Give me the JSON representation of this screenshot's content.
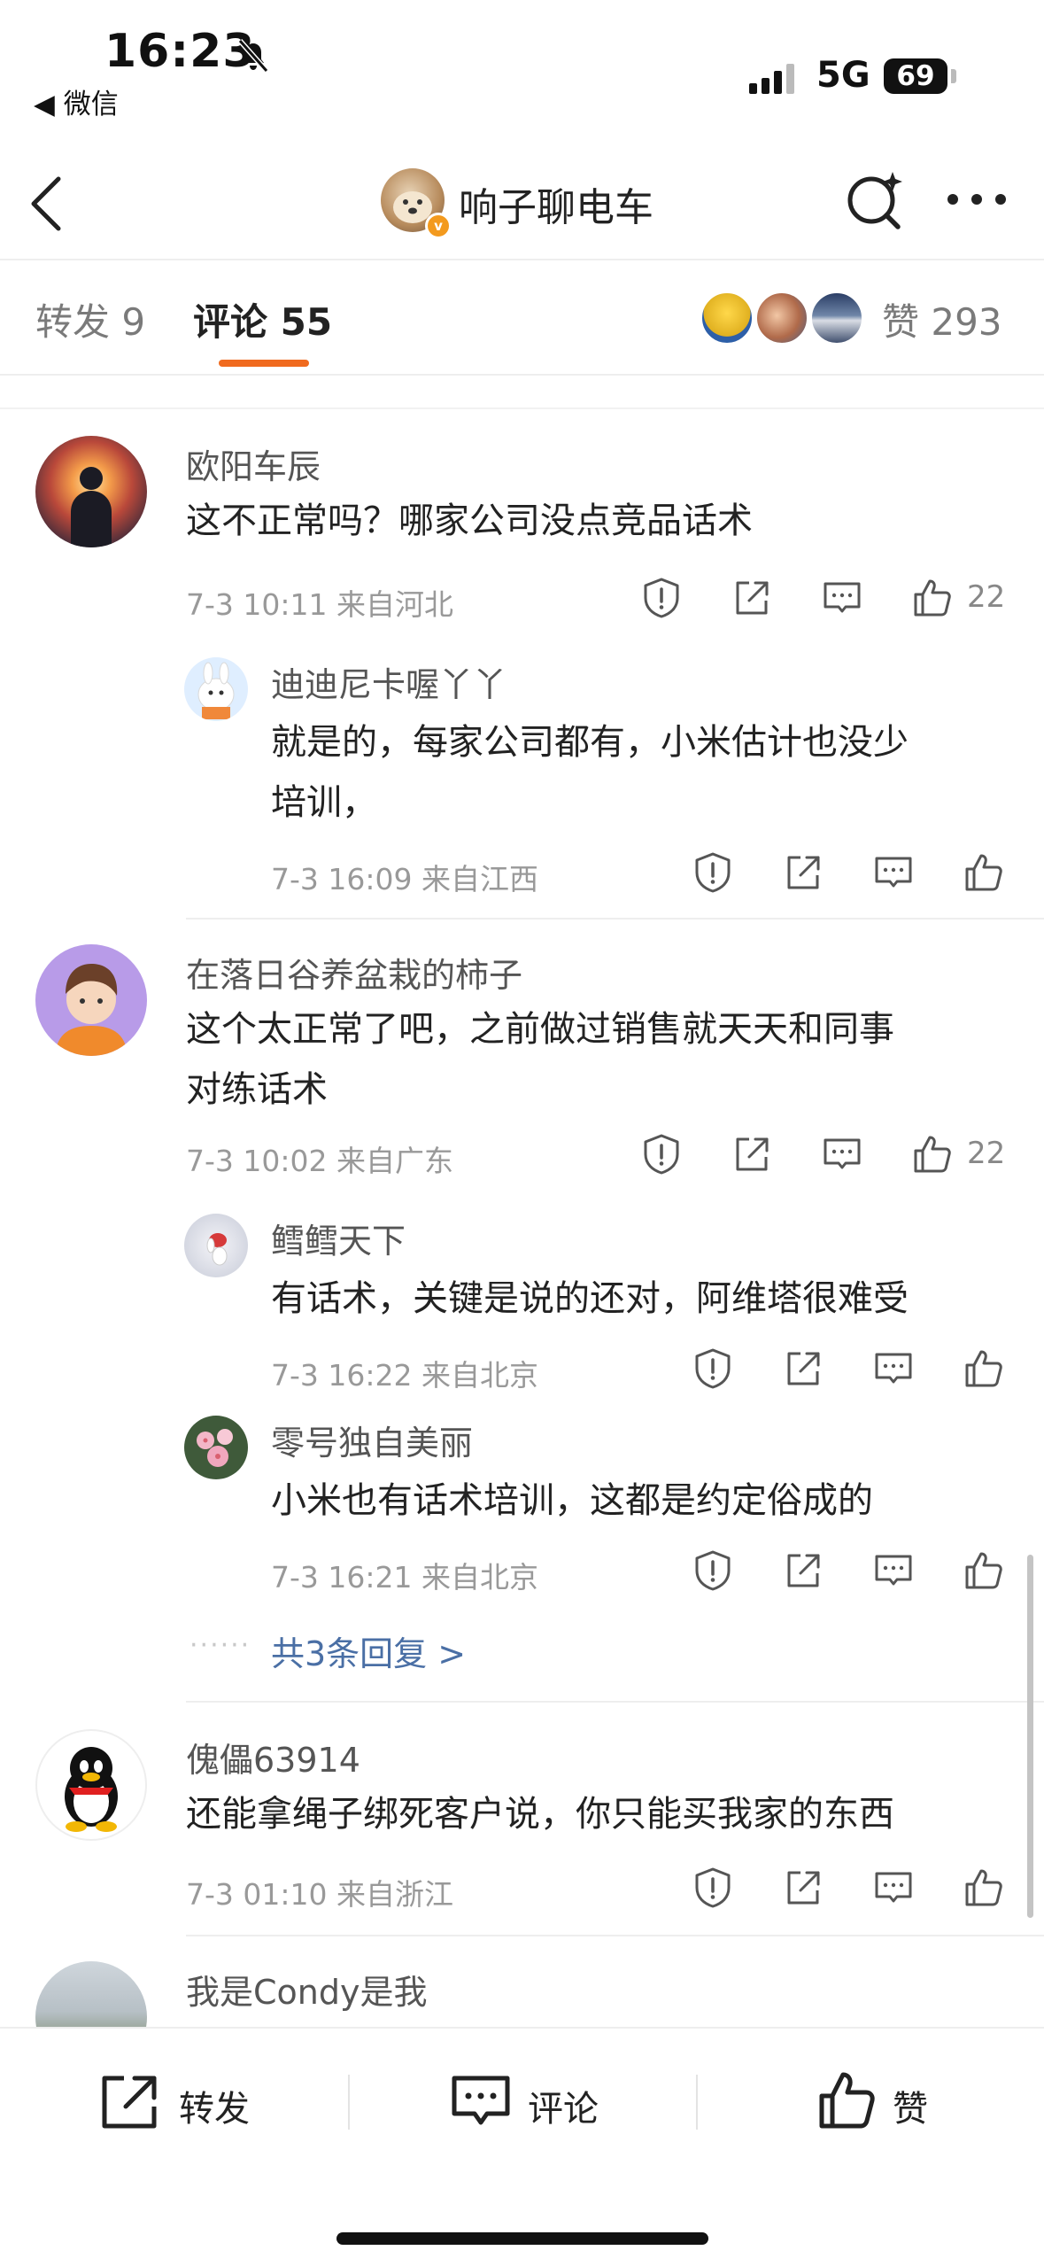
{
  "status_bar": {
    "time": "16:23",
    "back_app": "◀ 微信",
    "network": "5G",
    "battery": "69"
  },
  "nav": {
    "title": "响子聊电车",
    "verified_mark": "v"
  },
  "tabs": {
    "repost": "转发 9",
    "comment": "评论 55",
    "likes": "赞 293"
  },
  "comments": [
    {
      "user": "欧阳车辰",
      "text": "这不正常吗？哪家公司没点竞品话术",
      "meta": "7-3 10:11 来自河北",
      "likes": "22",
      "replies": [
        {
          "user": "迪迪尼卡喔丫丫",
          "text_lines": [
            "就是的，每家公司都有，小米估计也没少",
            "培训，"
          ],
          "meta": "7-3 16:09 来自江西"
        }
      ]
    },
    {
      "user": "在落日谷养盆栽的柿子",
      "text_lines": [
        "这个太正常了吧，之前做过销售就天天和同事",
        "对练话术"
      ],
      "meta": "7-3 10:02 来自广东",
      "likes": "22",
      "replies": [
        {
          "user": "鳕鳕天下",
          "text": "有话术，关键是说的还对，阿维塔很难受",
          "meta": "7-3 16:22 来自北京"
        },
        {
          "user": "零号独自美丽",
          "text": "小米也有话术培训，这都是约定俗成的",
          "meta": "7-3 16:21 来自北京"
        }
      ],
      "more_dots": "······",
      "more_replies": "共3条回复 >"
    },
    {
      "user": "傀儡63914",
      "text": "还能拿绳子绑死客户说，你只能买我家的东西",
      "meta": "7-3 01:10 来自浙江"
    },
    {
      "user": "我是Condy是我"
    }
  ],
  "bottom_bar": {
    "repost": "转发",
    "comment": "评论",
    "like": "赞"
  },
  "colors": {
    "accent": "#f06a1e",
    "link": "#4a6fa5",
    "muted": "#999999"
  },
  "icons": [
    "bell-slash-icon",
    "signal-icon",
    "back-arrow-icon",
    "search-sparkle-icon",
    "more-icon",
    "report-icon",
    "share-icon",
    "reply-icon",
    "thumb-up-icon"
  ]
}
